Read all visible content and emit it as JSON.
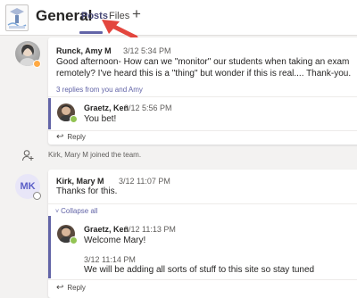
{
  "header": {
    "team_name": "General",
    "tabs": [
      {
        "label": "Posts"
      },
      {
        "label": "Files"
      }
    ],
    "add_tab_symbol": "+"
  },
  "colors": {
    "accent": "#6264a7",
    "online": "#92c353",
    "away": "#ffaa44",
    "arrow": "#e3463e"
  },
  "posts": [
    {
      "sender": "Runck, Amy M",
      "time": "3/12 5:34 PM",
      "text": "Good afternoon- How can we \"monitor\" our students when taking an exam remotely? I've heard this is a \"thing\" but wonder if this is real.... Thank-you.",
      "replies_link": "3 replies from you and Amy",
      "replies": [
        {
          "sender": "Graetz, Ken",
          "time": "3/12 5:56 PM",
          "text": "You bet!"
        }
      ],
      "reply_label": "Reply"
    },
    {
      "sender": "Kirk, Mary M",
      "avatar_initials": "MK",
      "time": "3/12 11:07 PM",
      "text": "Thanks for this.",
      "collapse_label": "Collapse all",
      "replies": [
        {
          "sender": "Graetz, Ken",
          "time": "3/12 11:13 PM",
          "text": "Welcome Mary!",
          "followup_time": "3/12 11:14 PM",
          "followup_text": "We will be adding all sorts of stuff to this site so stay tuned"
        }
      ],
      "reply_label": "Reply"
    }
  ],
  "system_message": "Kirk, Mary M joined the team."
}
